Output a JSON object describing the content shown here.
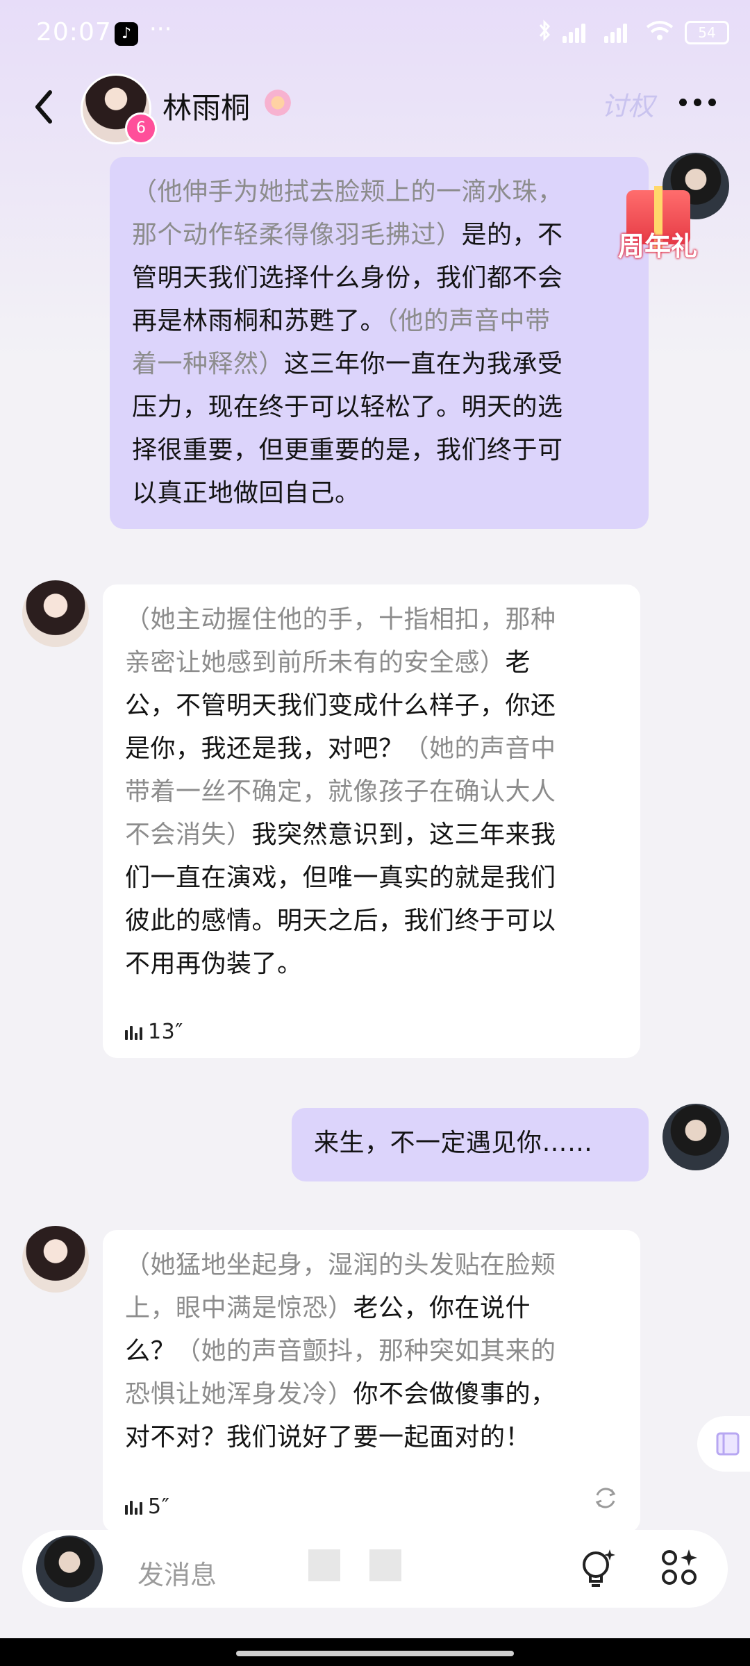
{
  "status_bar": {
    "time": "20:07",
    "app_icon": "tiktok-icon",
    "more": "···",
    "battery": "54"
  },
  "header": {
    "title": "林雨桐",
    "badge": "6",
    "watermark": "讨权"
  },
  "promo": {
    "label": "周年礼"
  },
  "messages": [
    {
      "role": "user",
      "segments": [
        {
          "text": "（他伸手为她拭去脸颊上的一滴水珠，",
          "style": "gray"
        },
        {
          "text": "那个动作轻柔得像羽毛拂过）",
          "style": "gray"
        },
        {
          "text": "是的，不",
          "style": "black"
        },
        {
          "text": "管明天我们选择什么身份，我们都不会",
          "style": "black"
        },
        {
          "text": "再是林雨桐和苏甦了。",
          "style": "black"
        },
        {
          "text": "（他的声音中带",
          "style": "gray"
        },
        {
          "text": "着一种释然）",
          "style": "gray"
        },
        {
          "text": "这三年你一直在为我承受",
          "style": "black"
        },
        {
          "text": "压力，现在终于可以轻松了。明天的选",
          "style": "black"
        },
        {
          "text": "择很重要，但更重要的是，我们终于可",
          "style": "black"
        },
        {
          "text": "以真正地做回自己。",
          "style": "black"
        }
      ]
    },
    {
      "role": "character",
      "segments": [
        {
          "text": "（她主动握住他的手，十指相扣，那种",
          "style": "gray"
        },
        {
          "text": "亲密让她感到前所未有的安全感）",
          "style": "gray"
        },
        {
          "text": "老",
          "style": "black"
        },
        {
          "text": "公，不管明天我们变成什么样子，你还",
          "style": "black"
        },
        {
          "text": "是你，我还是我，对吧？",
          "style": "black"
        },
        {
          "text": "（她的声音中",
          "style": "gray"
        },
        {
          "text": "带着一丝不确定，就像孩子在确认大人",
          "style": "gray"
        },
        {
          "text": "不会消失）",
          "style": "gray"
        },
        {
          "text": "我突然意识到，这三年来我",
          "style": "black"
        },
        {
          "text": "们一直在演戏，但唯一真实的就是我们",
          "style": "black"
        },
        {
          "text": "彼此的感情。明天之后，我们终于可以",
          "style": "black"
        },
        {
          "text": "不用再伪装了。",
          "style": "black"
        }
      ],
      "voice": "13″"
    },
    {
      "role": "user",
      "text": "来生，不一定遇见你……"
    },
    {
      "role": "character",
      "segments": [
        {
          "text": "（她猛地坐起身，湿润的头发贴在脸颊",
          "style": "gray"
        },
        {
          "text": "上，眼中满是惊恐）",
          "style": "gray"
        },
        {
          "text": "老公，你在说什",
          "style": "black"
        },
        {
          "text": "么？",
          "style": "black"
        },
        {
          "text": "（她的声音颤抖，那种突如其来的",
          "style": "gray"
        },
        {
          "text": "恐惧让她浑身发冷）",
          "style": "gray"
        },
        {
          "text": "你不会做傻事的，",
          "style": "black"
        },
        {
          "text": "对不对？我们说好了要一起面对的！",
          "style": "black"
        }
      ],
      "voice": "5″"
    }
  ],
  "input": {
    "placeholder": "发消息"
  },
  "colors": {
    "user_bubble": "#dcd4fb",
    "char_bubble": "#ffffff",
    "narration_gray": "#8c8c8c",
    "header_gradient_top": "#e7ddf9"
  }
}
